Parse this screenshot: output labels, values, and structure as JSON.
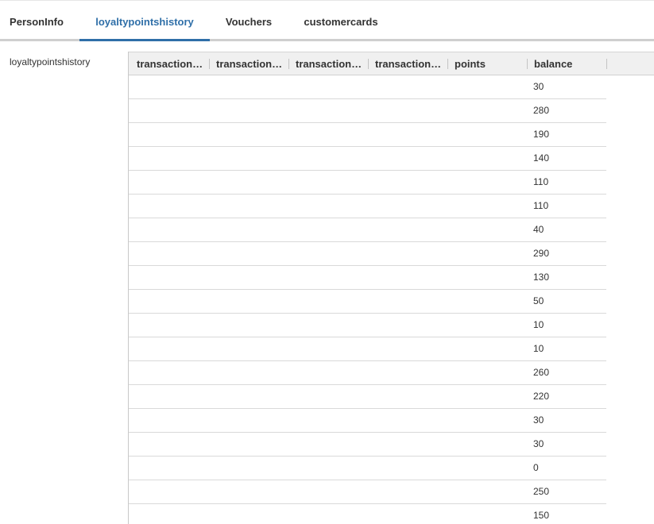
{
  "tabs": [
    {
      "label": "PersonInfo",
      "active": false
    },
    {
      "label": "loyaltypointshistory",
      "active": true
    },
    {
      "label": "Vouchers",
      "active": false
    },
    {
      "label": "customercards",
      "active": false
    }
  ],
  "section_label": "loyaltypointshistory",
  "grid": {
    "columns": [
      "transaction…",
      "transaction…",
      "transaction…",
      "transaction…",
      "points",
      "balance"
    ],
    "balances": [
      "30",
      "280",
      "190",
      "140",
      "110",
      "110",
      "40",
      "290",
      "130",
      "50",
      "10",
      "10",
      "260",
      "220",
      "30",
      "30",
      "0",
      "250",
      "150"
    ]
  },
  "colors": {
    "accent": "#2f6fa8",
    "header_bg": "#f0f0f0",
    "row_border": "#d9d9d9"
  }
}
